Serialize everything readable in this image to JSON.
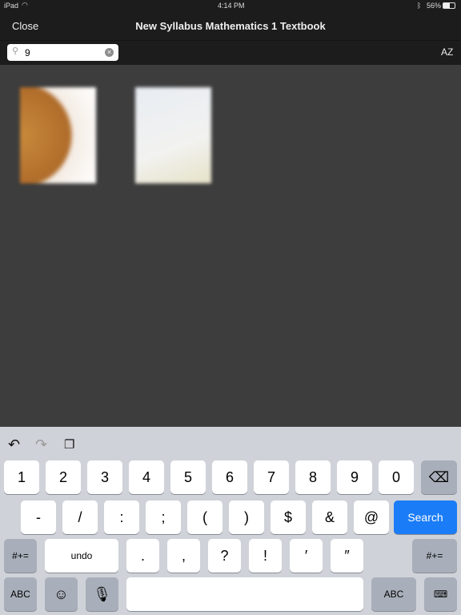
{
  "status": {
    "device": "iPad",
    "time": "4:14 PM",
    "battery": "56%"
  },
  "nav": {
    "close": "Close",
    "title": "New Syllabus Mathematics 1 Textbook"
  },
  "search": {
    "value": "9",
    "sort_label": "AZ"
  },
  "results": [
    {
      "name": "result-thumbnail-1"
    },
    {
      "name": "result-thumbnail-2"
    }
  ],
  "keyboard": {
    "row1": [
      "1",
      "2",
      "3",
      "4",
      "5",
      "6",
      "7",
      "8",
      "9",
      "0"
    ],
    "row2": [
      "-",
      "/",
      ":",
      ";",
      "(",
      ")",
      "$",
      "&",
      "@"
    ],
    "search": "Search",
    "row3_mode": "#+=",
    "undo": "undo",
    "row3": [
      ".",
      ",",
      "?",
      "!",
      "′",
      "″"
    ],
    "abc": "ABC",
    "search_color": "#1a7cf7"
  }
}
